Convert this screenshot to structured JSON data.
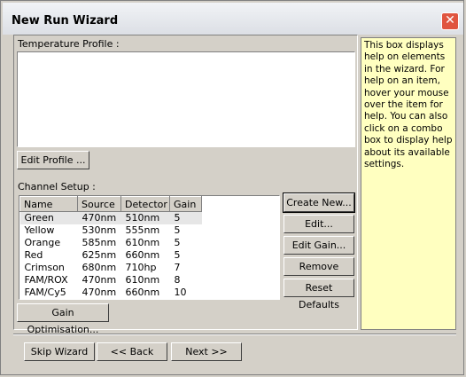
{
  "window": {
    "title": "New Run Wizard",
    "close_symbol": "✕"
  },
  "temperature_profile": {
    "label": "Temperature Profile :"
  },
  "buttons": {
    "edit_profile": "Edit Profile ...",
    "create_new": "Create New...",
    "edit": "Edit...",
    "edit_gain": "Edit Gain...",
    "remove": "Remove",
    "reset_defaults": "Reset Defaults",
    "gain_optimisation": "Gain Optimisation...",
    "skip_wizard": "Skip Wizard",
    "back": "<< Back",
    "next": "Next >>"
  },
  "channel_setup": {
    "label": "Channel Setup :",
    "columns": [
      "Name",
      "Source",
      "Detector",
      "Gain"
    ],
    "rows": [
      [
        "Green",
        "470nm",
        "510nm",
        "5"
      ],
      [
        "Yellow",
        "530nm",
        "555nm",
        "5"
      ],
      [
        "Orange",
        "585nm",
        "610nm",
        "5"
      ],
      [
        "Red",
        "625nm",
        "660nm",
        "5"
      ],
      [
        "Crimson",
        "680nm",
        "710hp",
        "7"
      ],
      [
        "FAM/ROX",
        "470nm",
        "610nm",
        "8"
      ],
      [
        "FAM/Cy5",
        "470nm",
        "660nm",
        "10"
      ]
    ]
  },
  "help_text": "This box displays help on elements in the wizard. For help on an item, hover your mouse over the item for help. You can also click on a combo box to display help about its available settings.",
  "colors": {
    "help_bg": "#ffffc0",
    "titlebar": "#e8ebf0",
    "close": "#e0553f"
  }
}
